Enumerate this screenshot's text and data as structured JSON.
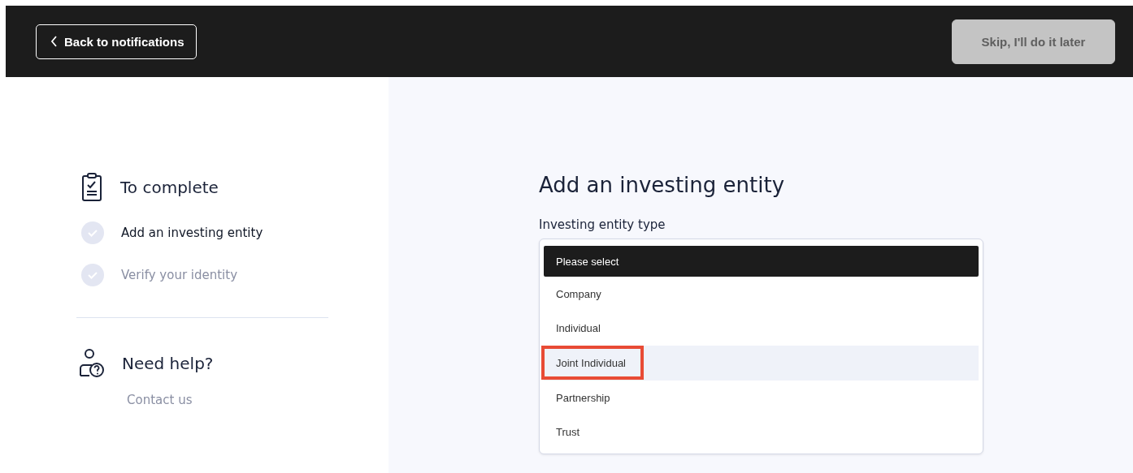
{
  "header": {
    "back_button": "Back to notifications",
    "skip_button": {
      "label": "Skip, I'll do it later",
      "disabled": true
    }
  },
  "sidebar": {
    "title": "To complete",
    "steps": [
      {
        "label": "Add an investing entity",
        "current": true
      },
      {
        "label": "Verify your identity",
        "current": false
      }
    ],
    "help": {
      "title": "Need help?",
      "link": "Contact us"
    }
  },
  "form": {
    "title": "Add an investing entity",
    "field_label": "Investing entity type",
    "options": [
      {
        "label": "Please select",
        "selected": true,
        "hovered": false,
        "marked": false
      },
      {
        "label": "Company",
        "selected": false,
        "hovered": false,
        "marked": false
      },
      {
        "label": "Individual",
        "selected": false,
        "hovered": false,
        "marked": false
      },
      {
        "label": "Joint Individual",
        "selected": false,
        "hovered": true,
        "marked": true
      },
      {
        "label": "Partnership",
        "selected": false,
        "hovered": false,
        "marked": false
      },
      {
        "label": "Trust",
        "selected": false,
        "hovered": false,
        "marked": false
      }
    ]
  }
}
